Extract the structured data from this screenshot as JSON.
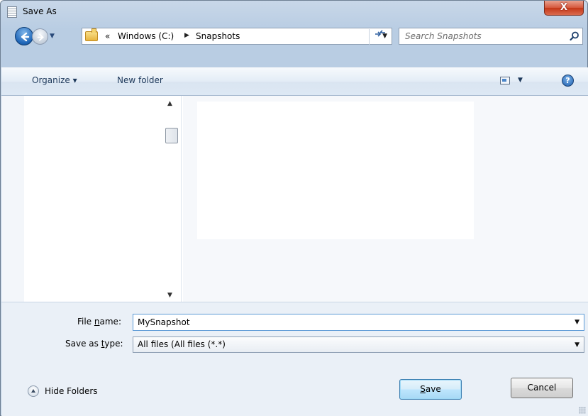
{
  "window": {
    "title": "Save As",
    "close_label": "X"
  },
  "nav": {
    "breadcrumb_prefix": "«",
    "breadcrumbs": [
      "Windows (C:)",
      "Snapshots"
    ],
    "search_placeholder": "Search Snapshots"
  },
  "toolbar": {
    "organize_label": "Organize ▾",
    "new_folder_label": "New folder",
    "help_label": "?"
  },
  "form": {
    "file_name_label_pre": "File ",
    "file_name_label_accel": "n",
    "file_name_label_post": "ame:",
    "file_name_value": "MySnapshot",
    "type_label_pre": "Save as ",
    "type_label_accel": "t",
    "type_label_post": "ype:",
    "type_value": "All files (All files (*.*)",
    "hide_folders_label": "Hide Folders"
  },
  "buttons": {
    "save_accel": "S",
    "save_rest": "ave",
    "cancel_label": "Cancel"
  }
}
